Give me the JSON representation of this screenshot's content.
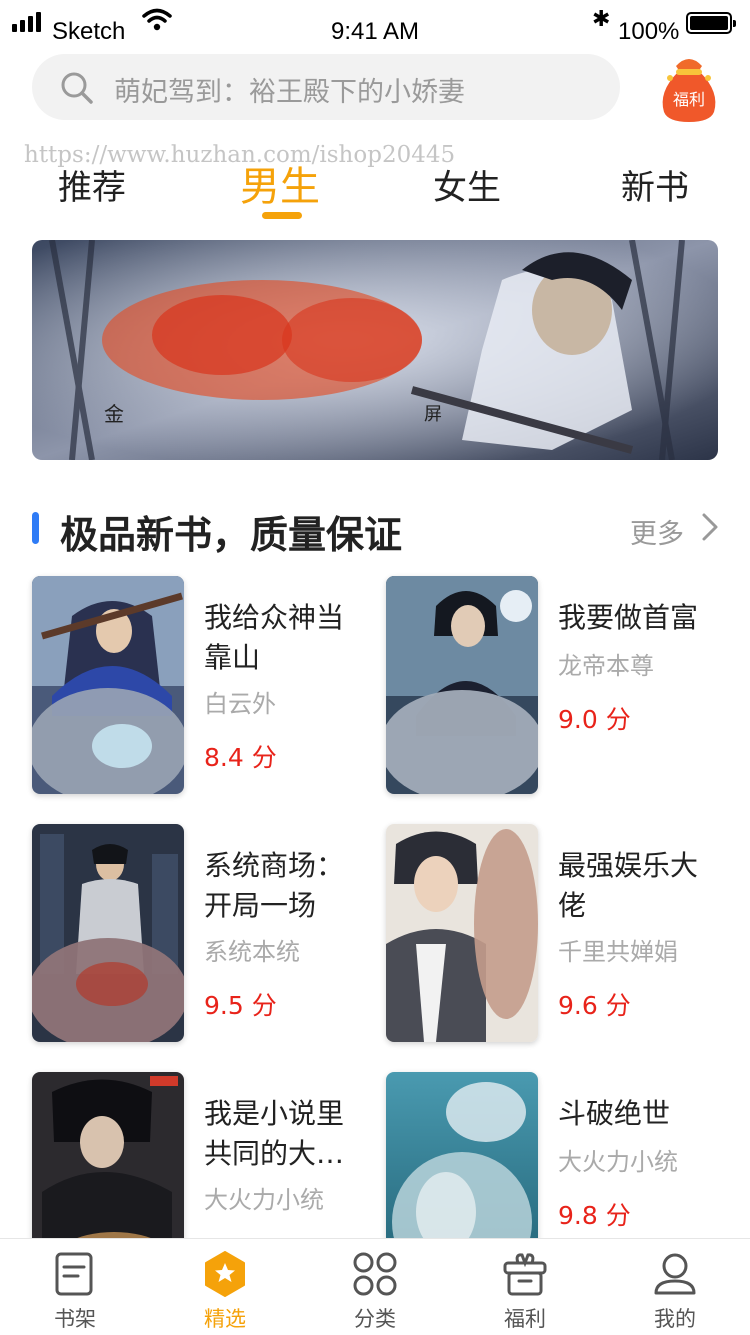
{
  "status_bar": {
    "carrier": "Sketch",
    "time": "9:41 AM",
    "battery": "100%"
  },
  "search": {
    "placeholder": "萌妃驾到：裕王殿下的小娇妻"
  },
  "welfare_badge": {
    "label": "福利"
  },
  "watermark": "https://www.huzhan.com/ishop20445",
  "tabs": [
    {
      "label": "推荐",
      "active": false
    },
    {
      "label": "男生",
      "active": true
    },
    {
      "label": "女生",
      "active": false
    },
    {
      "label": "新书",
      "active": false
    }
  ],
  "banner": {
    "caption_left": "金",
    "caption_right": "屏"
  },
  "section": {
    "title": "极品新书，质量保证",
    "more_label": "更多"
  },
  "books": [
    {
      "title": "我给众神当靠山",
      "author": "白云外",
      "score": "8.4 分"
    },
    {
      "title": "我要做首富",
      "author": "龙帝本尊",
      "score": "9.0 分"
    },
    {
      "title": "系统商场：开局一场",
      "author": "系统本统",
      "score": "9.5 分"
    },
    {
      "title": "最强娱乐大佬",
      "author": "千里共婵娟",
      "score": "9.6 分"
    },
    {
      "title": "我是小说里共同的大…",
      "author": "大火力小统",
      "score": ""
    },
    {
      "title": "斗破绝世",
      "author": "大火力小统",
      "score": "9.8 分"
    }
  ],
  "tab_bar": [
    {
      "label": "书架",
      "icon": "bookshelf-icon",
      "active": false
    },
    {
      "label": "精选",
      "icon": "featured-star-icon",
      "active": true
    },
    {
      "label": "分类",
      "icon": "category-grid-icon",
      "active": false
    },
    {
      "label": "福利",
      "icon": "gift-icon",
      "active": false
    },
    {
      "label": "我的",
      "icon": "profile-icon",
      "active": false
    }
  ],
  "colors": {
    "accent": "#f5a20a",
    "score": "#e8231a",
    "section_bar": "#2f7cf6"
  }
}
